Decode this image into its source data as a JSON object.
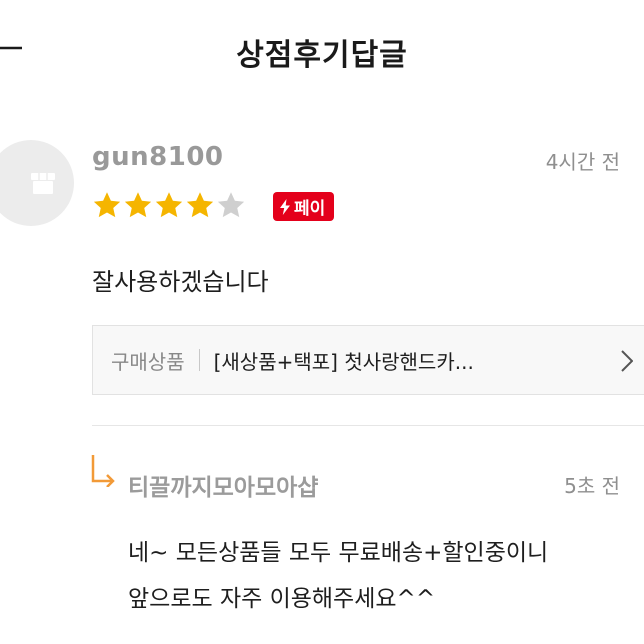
{
  "header": {
    "title": "상점후기답글",
    "back_icon": "arrow-left-icon"
  },
  "review": {
    "username": "gun8100",
    "time": "4시간 전",
    "rating": 4,
    "rating_max": 5,
    "badge_label": "페이",
    "badge_color": "#e4001b",
    "star_color": "#f5b500",
    "text": "잘사용하겠습니다",
    "product": {
      "label": "구매상품",
      "name": "[새상품+택포] 첫사랑핸드카..."
    }
  },
  "reply": {
    "author": "티끌까지모아모아샵",
    "time": "5초 전",
    "lines": [
      "네~ 모든상품들 모두 무료배송+할인중이니",
      "앞으로도 자주 이용해주세요^^"
    ],
    "accent_color": "#f29a37"
  }
}
